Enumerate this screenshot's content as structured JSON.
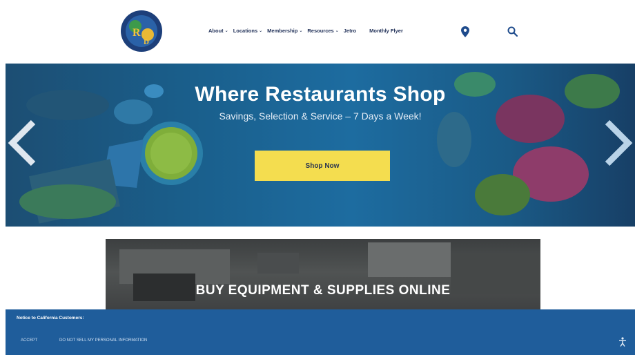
{
  "brand": {
    "logo_text_top": "Where Restaurants Shop",
    "logo_letters": "RD"
  },
  "nav": {
    "items": [
      {
        "label": "About",
        "has_caret": true
      },
      {
        "label": "Locations",
        "has_caret": true
      },
      {
        "label": "Membership",
        "has_caret": true
      },
      {
        "label": "Resources",
        "has_caret": true
      },
      {
        "label": "Jetro",
        "has_caret": false
      }
    ],
    "flyer": "Monthly Flyer",
    "location_icon": "map-pin-icon",
    "search_icon": "search-icon"
  },
  "hero": {
    "title": "Where Restaurants Shop",
    "subtitle": "Savings, Selection & Service – 7 Days a Week!",
    "button": "Shop Now",
    "button_color": "#f4dd4f"
  },
  "equipment": {
    "title": "BUY EQUIPMENT & SUPPLIES ONLINE"
  },
  "notice": {
    "title": "Notice to California Customers:",
    "accept": "ACCEPT",
    "do_not_sell": "DO NOT SELL MY PERSONAL INFORMATION",
    "background": "#1f5d9b"
  },
  "colors": {
    "nav_text": "#1e2e56",
    "hero_blue": "#1a5f8c"
  }
}
